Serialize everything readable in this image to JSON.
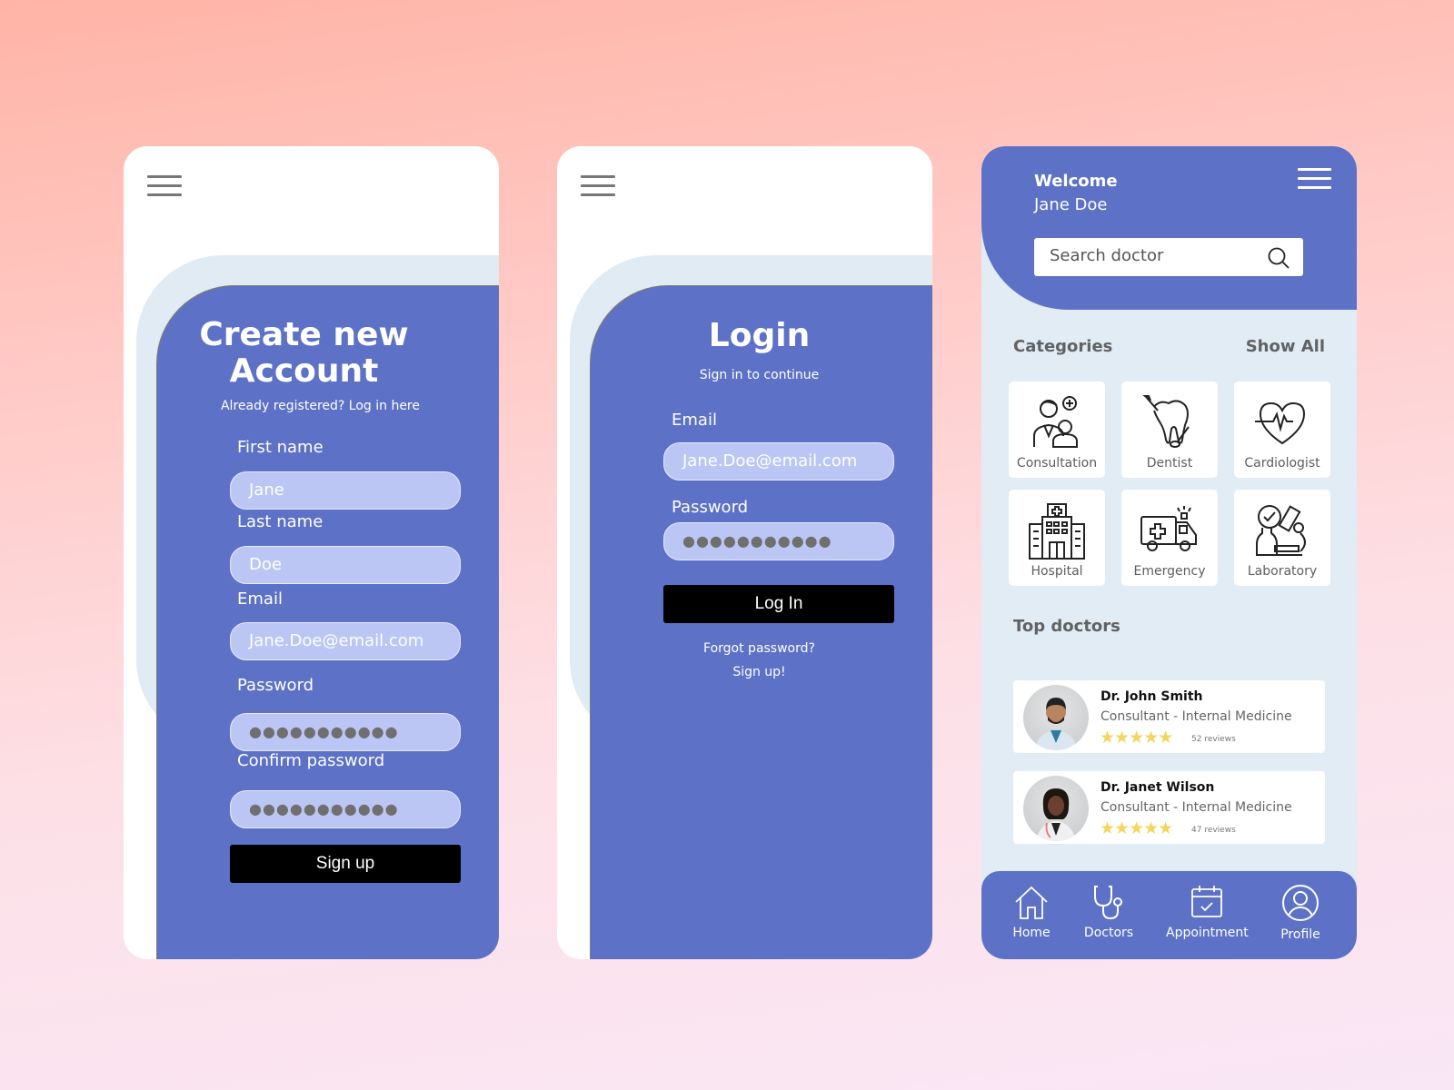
{
  "colors": {
    "primary": "#5d71c6",
    "field_bg": "#bbc6f5",
    "panel_bg": "#e1ecf5",
    "button": "#000000",
    "star": "#f3d65f"
  },
  "signup": {
    "title_line1": "Create new",
    "title_line2": "Account",
    "subtitle": "Already registered? Log in here",
    "fields": [
      {
        "label": "First name",
        "value": "Jane"
      },
      {
        "label": "Last name",
        "value": "Doe"
      },
      {
        "label": "Email",
        "value": "Jane.Doe@email.com"
      },
      {
        "label": "Password",
        "value": "●●●●●●●●●●●"
      },
      {
        "label": "Confirm password",
        "value": "●●●●●●●●●●●"
      }
    ],
    "button": "Sign up",
    "menu_icon": "hamburger-menu-icon"
  },
  "login": {
    "title": "Login",
    "subtitle": "Sign in to continue",
    "fields": [
      {
        "label": "Email",
        "value": "Jane.Doe@email.com"
      },
      {
        "label": "Password",
        "value": "●●●●●●●●●●●"
      }
    ],
    "button": "Log In",
    "forgot": "Forgot password?",
    "signup_link": "Sign up!",
    "menu_icon": "hamburger-menu-icon"
  },
  "home": {
    "welcome": "Welcome",
    "user": "Jane Doe",
    "search_placeholder": "Search doctor",
    "categories_title": "Categories",
    "show_all": "Show All",
    "categories": [
      {
        "label": "Consultation",
        "icon": "consultation-icon"
      },
      {
        "label": "Dentist",
        "icon": "tooth-icon"
      },
      {
        "label": "Cardiologist",
        "icon": "heartbeat-icon"
      },
      {
        "label": "Hospital",
        "icon": "hospital-icon"
      },
      {
        "label": "Emergency",
        "icon": "ambulance-icon"
      },
      {
        "label": "Laboratory",
        "icon": "microscope-icon"
      }
    ],
    "top_doctors_title": "Top doctors",
    "doctors": [
      {
        "name": "Dr. John Smith",
        "role": "Consultant - Internal Medicine",
        "rating": 5,
        "stars": "★★★★★",
        "reviews": "52 reviews"
      },
      {
        "name": "Dr. Janet Wilson",
        "role": "Consultant - Internal Medicine",
        "rating": 5,
        "stars": "★★★★★",
        "reviews": "47 reviews"
      }
    ],
    "nav": [
      {
        "label": "Home",
        "icon": "home-icon"
      },
      {
        "label": "Doctors",
        "icon": "stethoscope-icon"
      },
      {
        "label": "Appointment",
        "icon": "calendar-icon"
      },
      {
        "label": "Profile",
        "icon": "profile-icon"
      }
    ]
  }
}
